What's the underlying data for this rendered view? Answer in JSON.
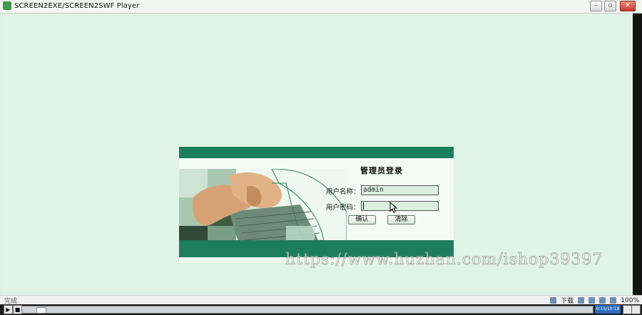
{
  "window": {
    "title": "SCREEN2EXE/SCREEN2SWF Player",
    "minimize": "–",
    "maximize": "▫",
    "close": "✕"
  },
  "login": {
    "title": "管理员登录",
    "username_label": "用户名称：",
    "username_value": "admin",
    "password_label": "用户密码：",
    "password_value": "",
    "confirm_button": "确认",
    "clear_button": "清除"
  },
  "watermark": "https://www.huzhan.com/ishop39397",
  "status": {
    "left_text": "完成",
    "download_label": "下载",
    "zoom": "100%"
  },
  "player": {
    "play": "▶",
    "stop": "■",
    "time": "0:15/10:18"
  },
  "colors": {
    "panel_green": "#1c7e5c",
    "background": "#dff3e6"
  }
}
